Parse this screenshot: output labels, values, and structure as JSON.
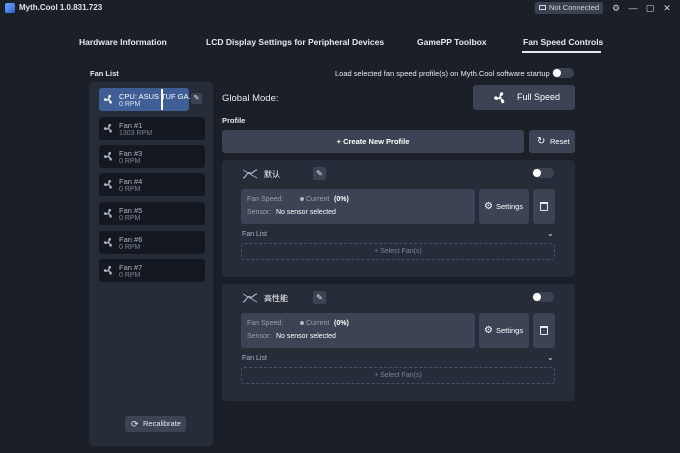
{
  "app": {
    "title": "Myth.Cool  1.0.831.723",
    "connection_status": "Not Connected"
  },
  "window_controls": {
    "settings": "⚙",
    "minimize": "—",
    "maximize": "▢",
    "close": "✕"
  },
  "tabs": [
    {
      "label": "Hardware Information"
    },
    {
      "label": "LCD Display Settings for Peripheral Devices"
    },
    {
      "label": "GamePP Toolbox"
    },
    {
      "label": "Fan Speed Controls",
      "active": true
    }
  ],
  "fan_list": {
    "title": "Fan List",
    "items": [
      {
        "name": "CPU: ASUS TUF GA...",
        "rpm": "0 RPM",
        "active": true
      },
      {
        "name": "Fan #1",
        "rpm": "1303 RPM"
      },
      {
        "name": "Fan #3",
        "rpm": "0 RPM"
      },
      {
        "name": "Fan #4",
        "rpm": "0 RPM"
      },
      {
        "name": "Fan #5",
        "rpm": "0 RPM"
      },
      {
        "name": "Fan #6",
        "rpm": "0 RPM"
      },
      {
        "name": "Fan #7",
        "rpm": "0 RPM"
      }
    ],
    "recalibrate_label": "Recalibrate"
  },
  "startup": {
    "text": "Load selected fan speed profile(s) on Myth.Cool software startup",
    "enabled": false
  },
  "global_mode": {
    "label": "Global Mode:",
    "button_label": "Full Speed"
  },
  "profile": {
    "label": "Profile",
    "create_label": "Create New Profile",
    "reset_label": "Reset",
    "cards": [
      {
        "name": "默认",
        "enabled": false,
        "fan_speed_label": "Fan Speed:",
        "current_label": "Current",
        "current_value": "(0%)",
        "sensor_label": "Sensor:",
        "sensor_value": "No sensor selected",
        "settings_label": "Settings",
        "fan_list_label": "Fan List",
        "select_label": "+ Select Fan(s)"
      },
      {
        "name": "高性能",
        "enabled": false,
        "fan_speed_label": "Fan Speed:",
        "current_label": "Current",
        "current_value": "(0%)",
        "sensor_label": "Sensor:",
        "sensor_value": "No sensor selected",
        "settings_label": "Settings",
        "fan_list_label": "Fan List",
        "select_label": "+ Select Fan(s)"
      }
    ]
  },
  "colors": {
    "background": "#1b1f27",
    "panel": "#262c38",
    "button": "#3b4354",
    "active_item": "#3f5e95"
  }
}
